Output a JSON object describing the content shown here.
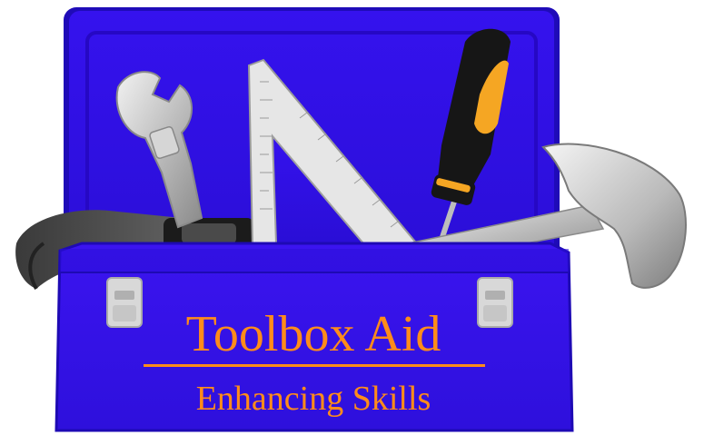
{
  "logo": {
    "title": "Toolbox Aid",
    "subtitle": "Enhancing Skills"
  },
  "colors": {
    "toolbox_blue": "#3a12e8",
    "toolbox_edge": "#1e0ab4",
    "text_orange": "#ff8c1a",
    "screwdriver_handle": "#1a1a1a",
    "screwdriver_grip": "#f5a623",
    "metal": "#c8c8c8"
  },
  "icons": [
    "toolbox-icon",
    "wrench-icon",
    "speed-square-icon",
    "screwdriver-icon",
    "hammer-icon",
    "pipe-wrench-icon",
    "latch-icon"
  ]
}
